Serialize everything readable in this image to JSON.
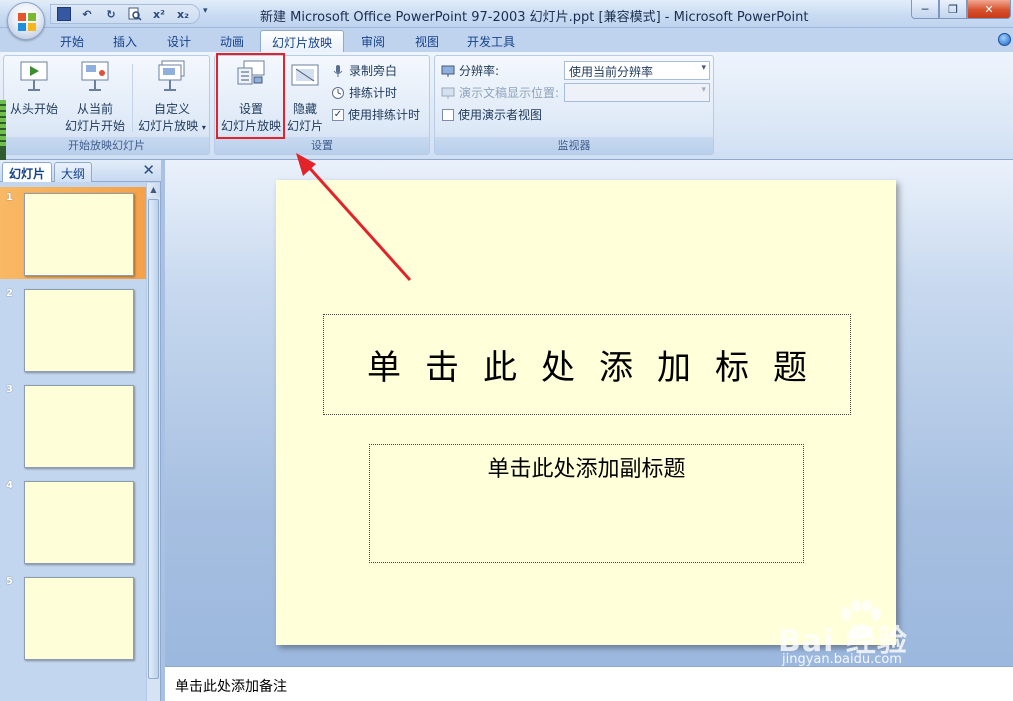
{
  "window": {
    "title": "新建 Microsoft Office PowerPoint 97-2003 幻灯片.ppt [兼容模式] - Microsoft PowerPoint",
    "minimize": "─",
    "restore": "❐",
    "close": "✕"
  },
  "qat": {
    "items": [
      {
        "icon": "save-icon",
        "glyph": "▪"
      },
      {
        "icon": "undo-icon",
        "glyph": "↶"
      },
      {
        "icon": "redo-icon",
        "glyph": "↻"
      },
      {
        "icon": "print-preview-icon",
        "glyph": "🔍"
      },
      {
        "icon": "superscript-icon",
        "glyph": "x²"
      },
      {
        "icon": "subscript-icon",
        "glyph": "x₂"
      }
    ],
    "more": "▾"
  },
  "tabs": [
    {
      "label": "开始"
    },
    {
      "label": "插入"
    },
    {
      "label": "设计"
    },
    {
      "label": "动画"
    },
    {
      "label": "幻灯片放映",
      "active": true
    },
    {
      "label": "审阅"
    },
    {
      "label": "视图"
    },
    {
      "label": "开发工具"
    }
  ],
  "ribbon": {
    "group_start": {
      "label": "开始放映幻灯片",
      "from_beginning": "从头开始",
      "from_current_1": "从当前",
      "from_current_2": "幻灯片开始",
      "custom_1": "自定义",
      "custom_2": "幻灯片放映",
      "custom_arrow": "▾"
    },
    "group_setup": {
      "label": "设置",
      "setup_1": "设置",
      "setup_2": "幻灯片放映",
      "hide_1": "隐藏",
      "hide_2": "幻灯片",
      "record": "录制旁白",
      "rehearse": "排练计时",
      "use_timings": "使用排练计时",
      "use_timings_checked": "✓"
    },
    "group_monitor": {
      "label": "监视器",
      "resolution_label": "分辨率:",
      "resolution_value": "使用当前分辨率",
      "show_on_label": "演示文稿显示位置:",
      "show_on_value": "",
      "presenter_view": "使用演示者视图"
    }
  },
  "left_pane": {
    "tab_slides": "幻灯片",
    "tab_outline": "大纲",
    "close": "✕",
    "slides": [
      {
        "num": "1",
        "selected": true
      },
      {
        "num": "2"
      },
      {
        "num": "3"
      },
      {
        "num": "4"
      },
      {
        "num": "5"
      }
    ]
  },
  "slide": {
    "title_placeholder": "单击此处添加标题",
    "subtitle_placeholder": "单击此处添加副标题"
  },
  "notes": {
    "placeholder": "单击此处添加备注"
  },
  "watermark": {
    "text": "Bai 经验",
    "url": "jingyan.baidu.com"
  },
  "colors": {
    "highlight": "#e2242a",
    "slide_bg": "#ffffd9",
    "selected_thumb": "#f4a24a"
  }
}
